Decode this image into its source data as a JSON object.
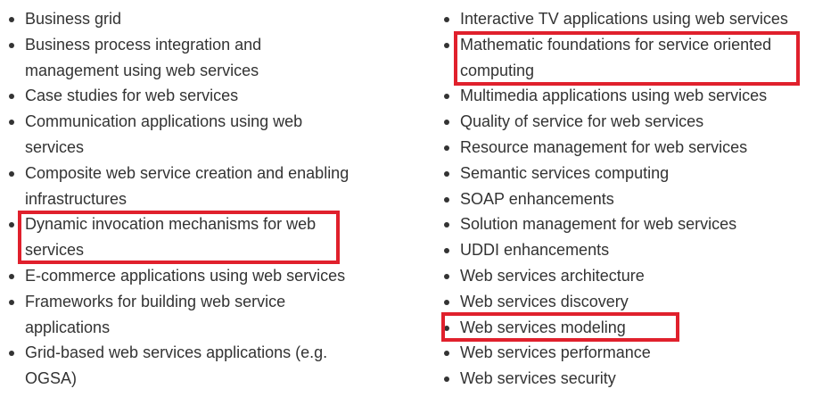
{
  "left_column": {
    "items": [
      {
        "label": "Business grid"
      },
      {
        "label": "Business process integration and management using web services"
      },
      {
        "label": "Case studies for web services"
      },
      {
        "label": "Communication applications using web services"
      },
      {
        "label": "Composite web service creation and enabling infrastructures"
      },
      {
        "label": "Dynamic invocation mechanisms for web services"
      },
      {
        "label": "E-commerce applications using web services"
      },
      {
        "label": "Frameworks for building web service applications"
      },
      {
        "label": "Grid-based web services applications (e.g. OGSA)"
      }
    ]
  },
  "right_column": {
    "items": [
      {
        "label": "Interactive TV applications using web services"
      },
      {
        "label": "Mathematic foundations for service oriented computing"
      },
      {
        "label": "Multimedia applications using web services"
      },
      {
        "label": "Quality of service for web services"
      },
      {
        "label": "Resource management for web services"
      },
      {
        "label": "Semantic services computing"
      },
      {
        "label": "SOAP enhancements"
      },
      {
        "label": "Solution management for web services"
      },
      {
        "label": "UDDI enhancements"
      },
      {
        "label": "Web services architecture"
      },
      {
        "label": "Web services discovery"
      },
      {
        "label": "Web services modeling"
      },
      {
        "label": "Web services performance"
      },
      {
        "label": "Web services security"
      }
    ]
  },
  "highlights": {
    "color": "#e0202c",
    "items": [
      "Dynamic invocation mechanisms for web services",
      "Mathematic foundations for service oriented computing",
      "Web services modeling"
    ]
  }
}
